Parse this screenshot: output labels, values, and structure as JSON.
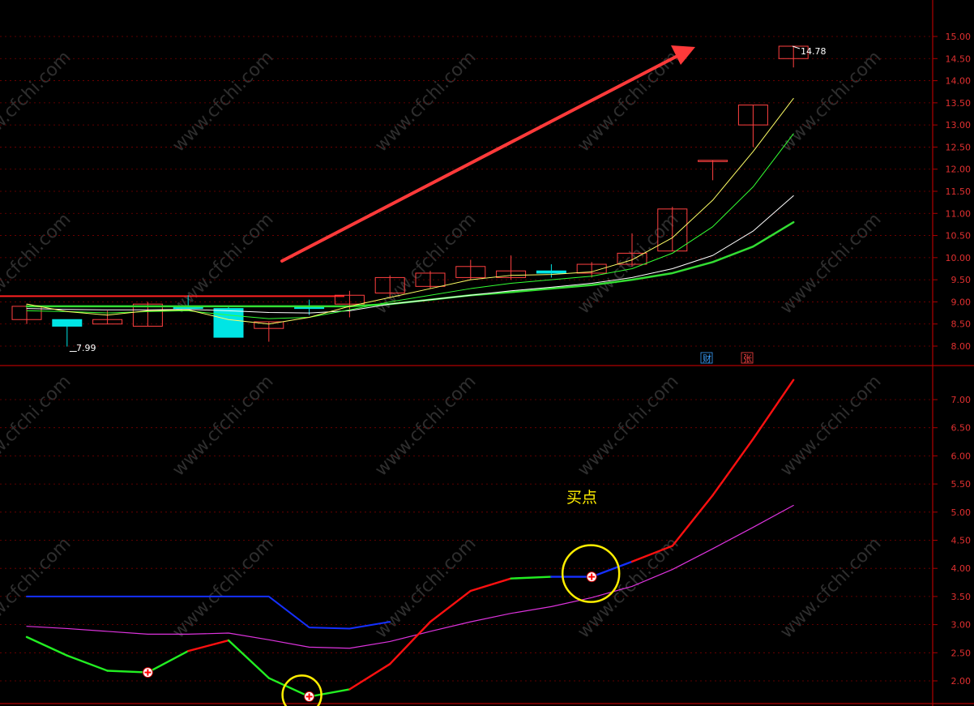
{
  "colors": {
    "background": "#000000",
    "grid": "#7a0000",
    "axis_line": "#b00000",
    "axis_text": "#e03030",
    "candle_up": "#ff4040",
    "candle_down": "#00e5e5",
    "ma_yellow": "#ffff66",
    "ma_green": "#33ff33",
    "ma_white": "#ffffff",
    "ma_green_thick": "#33dd33",
    "resistance_red": "#ff2020",
    "trend_arrow": "#ff3a3a",
    "ind_red": "#ff1010",
    "ind_green": "#22ee22",
    "ind_blue": "#1530ff",
    "ind_magenta": "#dd33dd",
    "circle_yellow": "#ffee00",
    "annotation_text": "#ffee00",
    "watermark": "#2e2e2e",
    "badge_cai": "#3aa0ff",
    "badge_zhang": "#ff4444"
  },
  "watermark_text": "www.cfchi.com",
  "price_panel": {
    "max_label": "14.78",
    "min_label": "7.99",
    "badge_1": "财",
    "badge_2": "张"
  },
  "indicator_panel": {
    "annotation": "买点"
  },
  "chart_data": [
    {
      "type": "candlestick",
      "panel": "price",
      "ylim": [
        7.7,
        15.2
      ],
      "y_ticks": [
        "15.00",
        "14.50",
        "14.00",
        "13.50",
        "13.00",
        "12.50",
        "12.00",
        "11.50",
        "11.00",
        "10.50",
        "10.00",
        "9.50",
        "9.00",
        "8.50",
        "8.00"
      ],
      "y_tick_values": [
        15.0,
        14.5,
        14.0,
        13.5,
        13.0,
        12.5,
        12.0,
        11.5,
        11.0,
        10.5,
        10.0,
        9.5,
        9.0,
        8.5,
        8.0
      ],
      "candles": [
        {
          "o": 8.6,
          "h": 8.95,
          "l": 8.5,
          "c": 8.9
        },
        {
          "o": 8.6,
          "h": 8.6,
          "l": 7.99,
          "c": 8.45
        },
        {
          "o": 8.5,
          "h": 8.8,
          "l": 8.5,
          "c": 8.6
        },
        {
          "o": 8.45,
          "h": 9.0,
          "l": 8.45,
          "c": 8.95
        },
        {
          "o": 8.9,
          "h": 9.15,
          "l": 8.85,
          "c": 8.85
        },
        {
          "o": 8.85,
          "h": 8.9,
          "l": 8.2,
          "c": 8.2
        },
        {
          "o": 8.4,
          "h": 8.55,
          "l": 8.1,
          "c": 8.55
        },
        {
          "o": 8.9,
          "h": 9.05,
          "l": 8.7,
          "c": 8.85
        },
        {
          "o": 8.95,
          "h": 9.25,
          "l": 8.65,
          "c": 9.15
        },
        {
          "o": 9.2,
          "h": 9.6,
          "l": 9.1,
          "c": 9.55
        },
        {
          "o": 9.35,
          "h": 9.7,
          "l": 9.3,
          "c": 9.65
        },
        {
          "o": 9.55,
          "h": 9.95,
          "l": 9.5,
          "c": 9.8
        },
        {
          "o": 9.55,
          "h": 10.05,
          "l": 9.5,
          "c": 9.7
        },
        {
          "o": 9.7,
          "h": 9.85,
          "l": 9.55,
          "c": 9.65
        },
        {
          "o": 9.65,
          "h": 9.9,
          "l": 9.55,
          "c": 9.85
        },
        {
          "o": 9.85,
          "h": 10.55,
          "l": 9.8,
          "c": 10.1
        },
        {
          "o": 10.15,
          "h": 11.15,
          "l": 10.15,
          "c": 11.1
        },
        {
          "o": 12.2,
          "h": 12.2,
          "l": 11.75,
          "c": 12.2
        },
        {
          "o": 13.0,
          "h": 13.45,
          "l": 12.5,
          "c": 13.45
        },
        {
          "o": 14.5,
          "h": 14.78,
          "l": 14.3,
          "c": 14.78
        }
      ],
      "ma_yellow": [
        8.95,
        8.78,
        8.7,
        8.8,
        8.82,
        8.6,
        8.5,
        8.65,
        8.9,
        9.1,
        9.3,
        9.5,
        9.6,
        9.62,
        9.68,
        9.95,
        10.45,
        11.3,
        12.4,
        13.6
      ],
      "ma_green": [
        8.8,
        8.78,
        8.75,
        8.78,
        8.8,
        8.7,
        8.62,
        8.65,
        8.82,
        9.0,
        9.15,
        9.3,
        9.42,
        9.5,
        9.58,
        9.75,
        10.1,
        10.7,
        11.6,
        12.8
      ],
      "ma_white": [
        8.85,
        8.83,
        8.82,
        8.82,
        8.83,
        8.8,
        8.76,
        8.75,
        8.8,
        8.95,
        9.05,
        9.15,
        9.25,
        9.33,
        9.42,
        9.55,
        9.75,
        10.05,
        10.6,
        11.4
      ],
      "ma_green_thick": [
        8.9,
        8.9,
        8.9,
        8.9,
        8.9,
        8.9,
        8.9,
        8.9,
        8.9,
        8.95,
        9.05,
        9.15,
        9.22,
        9.3,
        9.38,
        9.5,
        9.65,
        9.9,
        10.25,
        10.8
      ],
      "resistance": 9.13
    },
    {
      "type": "line",
      "panel": "indicator",
      "ylim": [
        1.75,
        7.4
      ],
      "y_ticks": [
        "7.00",
        "6.50",
        "6.00",
        "5.50",
        "5.00",
        "4.50",
        "4.00",
        "3.50",
        "3.00",
        "2.50",
        "2.00"
      ],
      "y_tick_values": [
        7.0,
        6.5,
        6.0,
        5.5,
        5.0,
        4.5,
        4.0,
        3.5,
        3.0,
        2.5,
        2.0
      ],
      "trend_line": [
        2.78,
        2.45,
        2.18,
        2.15,
        2.53,
        2.72,
        2.05,
        1.72,
        1.85,
        2.3,
        3.05,
        3.6,
        3.82,
        3.85,
        3.85,
        4.12,
        4.4,
        5.3,
        6.3,
        7.35
      ],
      "trend_red_ranges": [
        [
          4,
          5
        ],
        [
          8,
          12
        ],
        [
          15,
          19
        ]
      ],
      "trend_blue_ranges": [
        [
          13,
          15
        ]
      ],
      "level_blue": [
        3.5,
        3.5,
        3.5,
        3.5,
        3.5,
        3.5,
        3.5,
        2.95,
        2.93,
        3.05
      ],
      "magenta": [
        2.97,
        2.93,
        2.88,
        2.83,
        2.83,
        2.85,
        2.73,
        2.6,
        2.58,
        2.7,
        2.88,
        3.05,
        3.2,
        3.32,
        3.48,
        3.68,
        3.98,
        4.35,
        4.73,
        5.12
      ],
      "buy_markers": [
        3,
        7,
        14
      ]
    }
  ]
}
